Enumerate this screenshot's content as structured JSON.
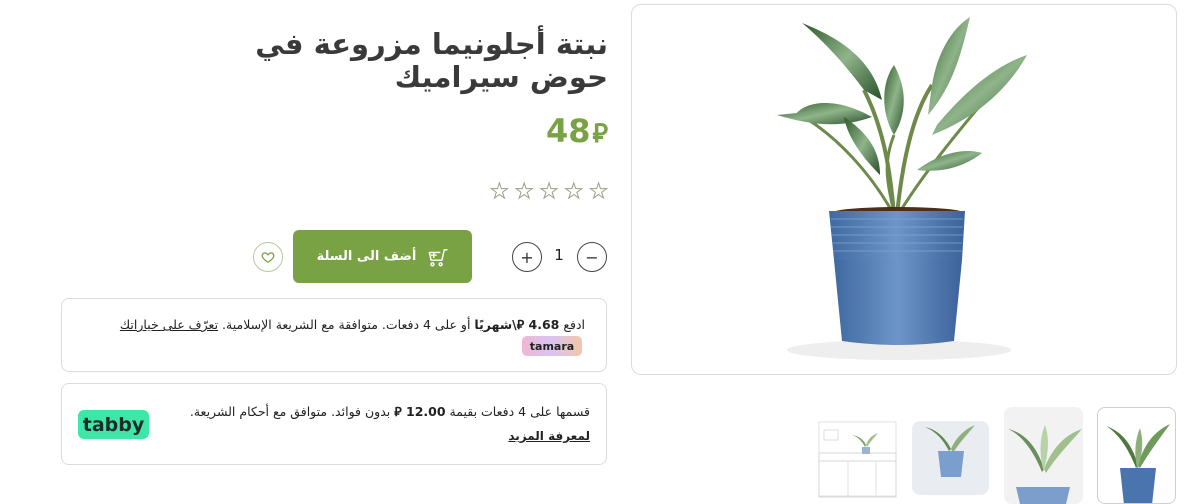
{
  "product": {
    "title": "نبتة أجلونيما مزروعة في حوض سيراميك",
    "price": "48",
    "currency_symbol": "⃁",
    "rating": {
      "value": 0,
      "max": 5
    },
    "quantity": "1",
    "add_to_cart_label": "أضف الى السلة",
    "brand_color": "#79a245"
  },
  "tamara": {
    "pay_prefix": "ادفع",
    "amount": "4.68",
    "per_month": "\\شهريًا",
    "rest": "أو على 4 دفعات. متوافقة مع الشريعة الإسلامية.",
    "link": "تعرّف على خياراتك",
    "logo": "tamara"
  },
  "tabby": {
    "line1_prefix": "قسمها على 4 دفعات بقيمة",
    "amount": "12.00",
    "line1_suffix": "بدون فوائد. متوافق مع أحكام الشريعة.",
    "link": "لمعرفة المزيد",
    "logo": "tabby",
    "logo_color": "#3ee6a7"
  },
  "icons": {
    "wishlist": "heart-outline-icon",
    "cart": "cart-plus-icon",
    "plus": "plus-icon",
    "minus": "minus-icon",
    "star": "star-outline-icon"
  },
  "gallery": {
    "thumbnails": [
      "plant-front",
      "plant-angle",
      "plant-small",
      "plant-in-room"
    ],
    "active_index": 0
  }
}
